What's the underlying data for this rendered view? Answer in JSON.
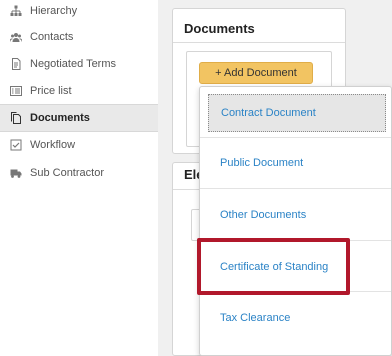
{
  "sidebar": {
    "items": [
      {
        "label": "Hierarchy",
        "icon": "hierarchy-icon"
      },
      {
        "label": "Contacts",
        "icon": "contacts-icon"
      },
      {
        "label": "Negotiated Terms",
        "icon": "document-icon"
      },
      {
        "label": "Price list",
        "icon": "list-icon"
      },
      {
        "label": "Documents",
        "icon": "documents-icon",
        "active": true
      },
      {
        "label": "Workflow",
        "icon": "checkbox-icon"
      },
      {
        "label": "Sub Contractor",
        "icon": "truck-icon"
      }
    ]
  },
  "documents_panel": {
    "title": "Documents",
    "add_button_label": "+ Add Document"
  },
  "second_panel": {
    "title_partial": "Ele"
  },
  "dropdown": {
    "items": [
      "Contract Document",
      "Public Document",
      "Other Documents",
      "Certificate of Standing",
      "Tax Clearance"
    ]
  },
  "colors": {
    "accent_button": "#f2c462",
    "link": "#2b83c6",
    "highlight": "#b1182b",
    "active_nav": "#e9e9e9"
  }
}
